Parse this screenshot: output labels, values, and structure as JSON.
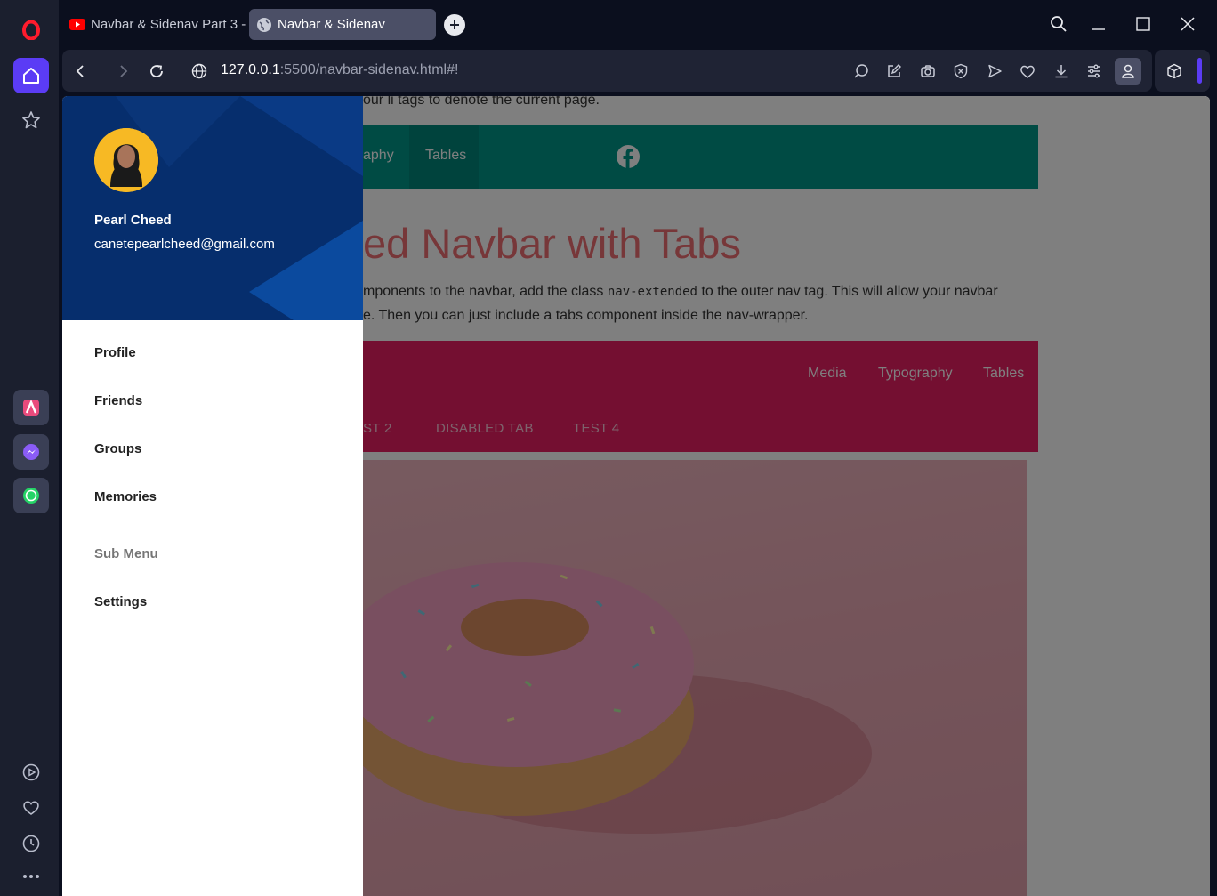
{
  "browser": {
    "tabs": [
      {
        "title": "Navbar & Sidenav Part 3 -",
        "icon": "youtube-icon"
      },
      {
        "title": "Navbar & Sidenav",
        "icon": "globe-icon"
      }
    ],
    "url_host": "127.0.0.1",
    "url_rest": ":5500/navbar-sidenav.html#!"
  },
  "page": {
    "intro_line": "our li tags to denote the current page.",
    "teal_nav": {
      "partial_item": "aphy",
      "active_item": "Tables"
    },
    "headline": "ed Navbar with Tabs",
    "para_line1_a": "mponents to the navbar, add the class ",
    "para_line1_code": "nav-extended",
    "para_line1_b": " to the outer nav tag. This will allow your navbar",
    "para_line2": "e. Then you can just include a tabs component inside the nav-wrapper.",
    "pink_nav": {
      "right_items": [
        "Media",
        "Typography",
        "Tables"
      ],
      "tabs": [
        "ST 2",
        "DISABLED TAB",
        "TEST 4"
      ]
    }
  },
  "sidenav": {
    "user_name": "Pearl Cheed",
    "user_email": "canetepearlcheed@gmail.com",
    "items": [
      "Profile",
      "Friends",
      "Groups",
      "Memories"
    ],
    "subheader": "Sub Menu",
    "sub_items": [
      "Settings"
    ]
  },
  "colors": {
    "teal": "#009688",
    "pink": "#e91e63",
    "headline": "#ee6e73",
    "user_bg": "#062e6d",
    "opera_accent": "#5b3cf5"
  }
}
